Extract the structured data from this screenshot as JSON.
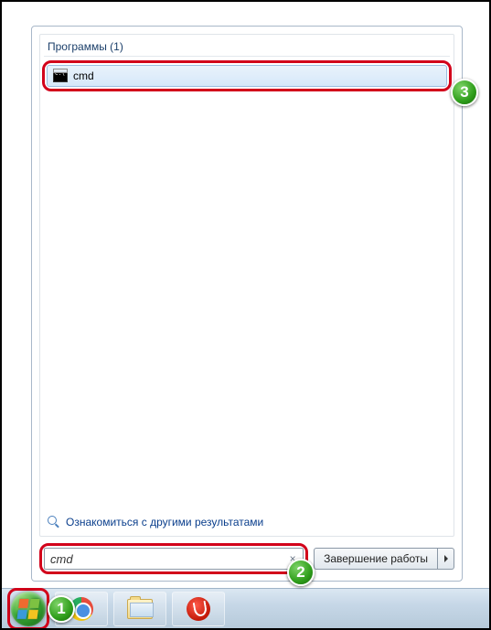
{
  "results": {
    "category_header": "Программы (1)",
    "items": [
      {
        "name": "cmd"
      }
    ],
    "more_results_label": "Ознакомиться с другими результатами"
  },
  "search": {
    "value": "cmd"
  },
  "shutdown": {
    "label": "Завершение работы"
  },
  "annotations": {
    "b1": "1",
    "b2": "2",
    "b3": "3"
  }
}
